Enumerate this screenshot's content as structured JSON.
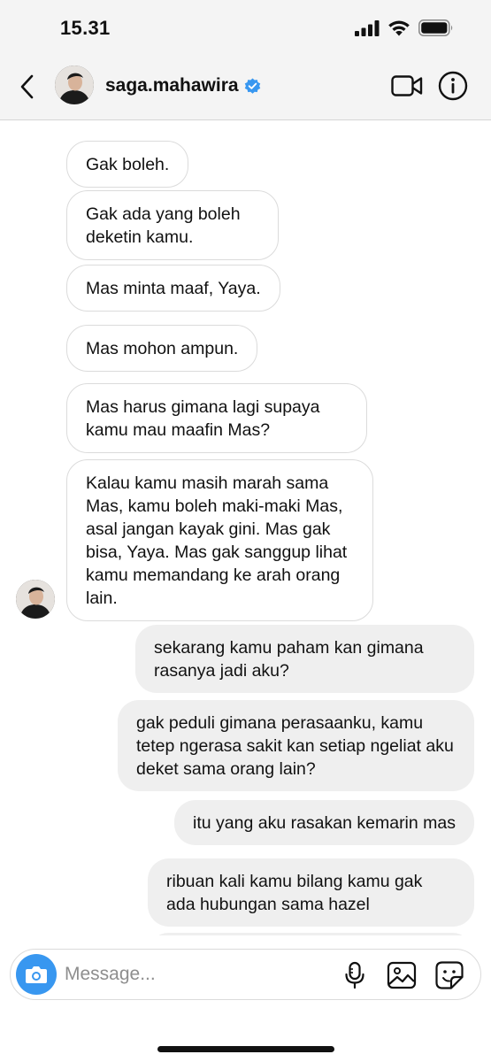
{
  "status_bar": {
    "time": "15.31",
    "icons": [
      "cellular-signal-icon",
      "wifi-icon",
      "battery-icon"
    ]
  },
  "header": {
    "username": "saga.mahawira",
    "verified": true,
    "icons": [
      "back-chevron-icon",
      "video-call-icon",
      "info-icon"
    ]
  },
  "messages": [
    {
      "direction": "incoming",
      "text": "Gak boleh."
    },
    {
      "direction": "incoming",
      "text": "Gak ada yang boleh deketin kamu."
    },
    {
      "direction": "incoming",
      "text": "Mas minta maaf, Yaya."
    },
    {
      "direction": "incoming",
      "text": "Mas mohon ampun."
    },
    {
      "direction": "incoming",
      "text": "Mas harus gimana lagi supaya kamu mau maafin Mas?"
    },
    {
      "direction": "incoming",
      "text": "Kalau kamu masih marah sama Mas, kamu boleh maki-maki Mas, asal jangan kayak gini. Mas gak bisa, Yaya. Mas gak sanggup lihat kamu memandang ke arah orang lain."
    },
    {
      "direction": "outgoing",
      "text": "sekarang kamu paham kan gimana rasanya jadi aku?"
    },
    {
      "direction": "outgoing",
      "text": "gak peduli gimana perasaanku, kamu tetep ngerasa sakit kan setiap ngeliat aku deket sama orang lain?"
    },
    {
      "direction": "outgoing",
      "text": "itu yang aku rasakan kemarin mas"
    },
    {
      "direction": "outgoing",
      "text": "ribuan kali kamu bilang kamu gak ada hubungan sama hazel"
    }
  ],
  "composer": {
    "placeholder": "Message...",
    "icons": [
      "camera-icon",
      "microphone-icon",
      "gallery-icon",
      "sticker-icon"
    ]
  },
  "colors": {
    "accent": "#3897f0",
    "incoming_bubble_border": "#dbdbdb",
    "outgoing_bubble": "#efefef",
    "header_bg": "#f4f4f4"
  }
}
